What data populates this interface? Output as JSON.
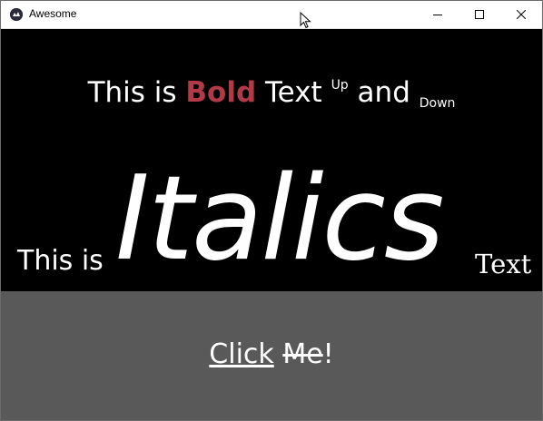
{
  "window": {
    "title": "Awesome"
  },
  "content": {
    "line1": {
      "prefix": "This is ",
      "bold": "Bold",
      "middle": " Text ",
      "superscript": "Up",
      "conjunction": " and ",
      "subscript": "Down"
    },
    "line2": {
      "prefix": "This is",
      "italic": "Italics",
      "suffix": "Text"
    }
  },
  "button": {
    "word1": "Click",
    "space": " ",
    "word2": "Me",
    "punct": "!"
  },
  "colors": {
    "background": "#000000",
    "button_bg": "#595959",
    "bold_text": "#b23a48",
    "text": "#ffffff"
  },
  "icons": {
    "app": "kivy-logo-icon",
    "minimize": "minimize-icon",
    "maximize": "maximize-icon",
    "close": "close-icon",
    "cursor": "mouse-cursor-icon"
  }
}
